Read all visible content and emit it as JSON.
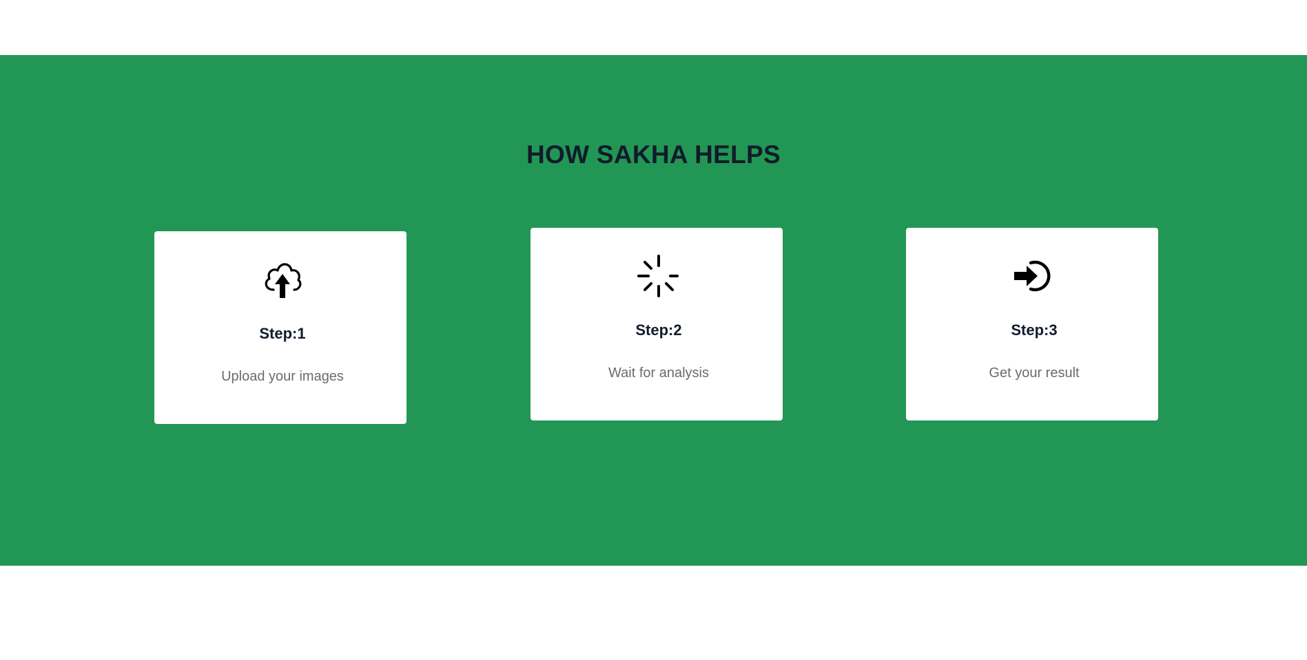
{
  "section": {
    "title": "HOW SAKHA HELPS",
    "background_color": "#229654"
  },
  "steps": [
    {
      "icon": "cloud-upload-icon",
      "label": "Step:1",
      "description": "Upload your images"
    },
    {
      "icon": "loading-spinner-icon",
      "label": "Step:2",
      "description": "Wait for analysis"
    },
    {
      "icon": "arrow-into-circle-icon",
      "label": "Step:3",
      "description": "Get your result"
    }
  ]
}
